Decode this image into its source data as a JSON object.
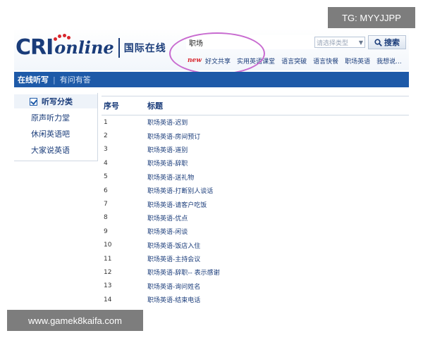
{
  "logo": {
    "brand": "CRI",
    "online": "online",
    "name_cn": "国际在线"
  },
  "search": {
    "query": "职场",
    "type_placeholder": "请选择类型",
    "button_label": "搜索"
  },
  "quicklinks": {
    "new_label": "new",
    "items": [
      "好文共享",
      "实用英语课堂",
      "语言突破",
      "语言快餐",
      "职场英语",
      "我想说..."
    ]
  },
  "navbar": {
    "item1": "在线听写",
    "separator": "|",
    "item2": "有问有答"
  },
  "sidebar": {
    "title": "听写分类",
    "items": [
      "原声听力堂",
      "休闲英语吧",
      "大家说英语"
    ]
  },
  "table": {
    "headers": [
      "序号",
      "标题"
    ],
    "rows": [
      [
        "1",
        "职场英语-迟到"
      ],
      [
        "2",
        "职场英语-房间预订"
      ],
      [
        "3",
        "职场英语-道别"
      ],
      [
        "4",
        "职场英语-辞职"
      ],
      [
        "5",
        "职场英语-送礼物"
      ],
      [
        "6",
        "职场英语-打断别人谈话"
      ],
      [
        "7",
        "职场英语-请客户吃饭"
      ],
      [
        "8",
        "职场英语-优点"
      ],
      [
        "9",
        "职场英语-闲谈"
      ],
      [
        "10",
        "职场英语-饭店入住"
      ],
      [
        "11",
        "职场英语-主持会议"
      ],
      [
        "12",
        "职场英语-辞职-- 表示感谢"
      ],
      [
        "13",
        "职场英语-询问姓名"
      ],
      [
        "14",
        "职场英语-结束电话"
      ]
    ]
  },
  "watermarks": {
    "tg": "TG: MYYJJPP",
    "site": "www.gamek8kaifa.com"
  },
  "colors": {
    "brand_blue": "#1a3c7a",
    "nav_blue": "#1e5aa8",
    "accent_red": "#d8262d",
    "highlight": "#c86bd0"
  }
}
